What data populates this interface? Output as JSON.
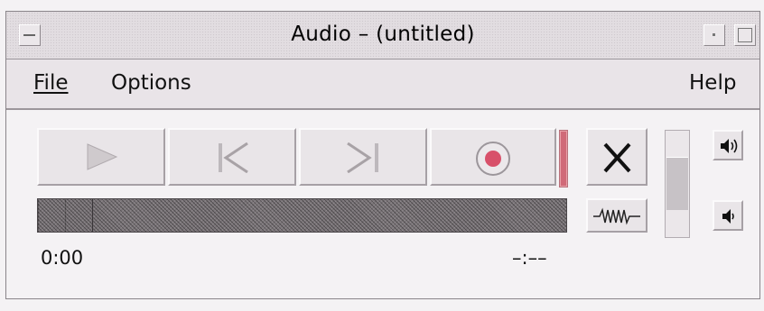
{
  "window": {
    "title": "Audio – (untitled)"
  },
  "menu": {
    "file_label": "File",
    "options_label": "Options",
    "help_label": "Help"
  },
  "transport": {
    "play_icon": "play-icon",
    "rewind_icon": "skip-to-start-icon",
    "forward_icon": "skip-to-end-icon",
    "record_icon": "record-icon",
    "stop_icon": "stop-x-icon",
    "waveform_icon": "waveform-icon",
    "record_color": "#d8506a"
  },
  "playback": {
    "position_fraction": 0.1,
    "current_time": "0:00",
    "total_time": "–:––"
  },
  "volume": {
    "level_fraction": 0.5,
    "volume_up_icon": "speaker-loud-icon",
    "volume_down_icon": "speaker-soft-icon"
  }
}
